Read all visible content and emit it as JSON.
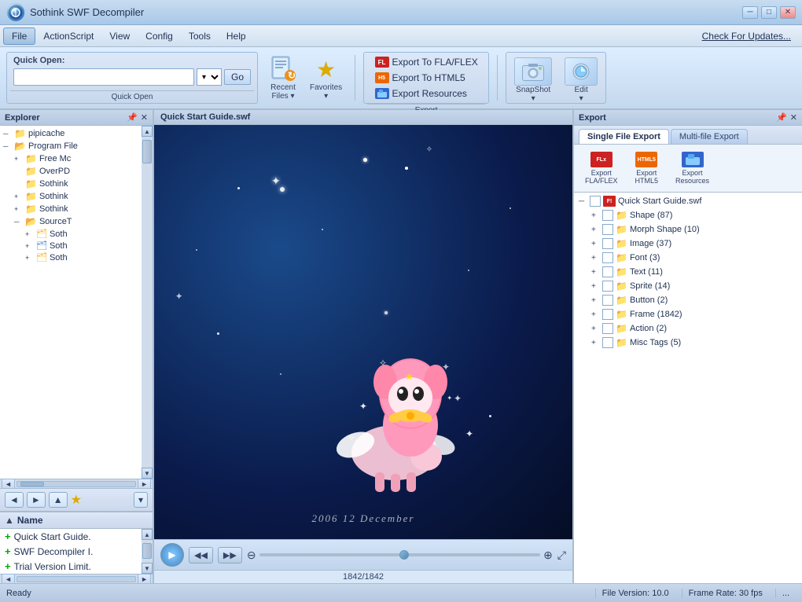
{
  "app": {
    "title": "Sothink SWF Decompiler",
    "icon": "◎"
  },
  "titleBar": {
    "title": "Sothink SWF Decompiler",
    "minimizeLabel": "─",
    "maximizeLabel": "□",
    "closeLabel": "✕"
  },
  "menuBar": {
    "items": [
      "File",
      "ActionScript",
      "View",
      "Config",
      "Tools",
      "Help"
    ],
    "activeItem": "File",
    "checkUpdates": "Check For Updates..."
  },
  "toolbar": {
    "quickOpenLabel": "Quick Open:",
    "goButton": "Go",
    "recentFilesLabel": "Recent\nFiles ▾",
    "favoritesLabel": "Favorites\n▾",
    "exportFlaFlexLabel": "Export To FLA/FLEX",
    "exportHtml5Label": "Export To HTML5",
    "exportResourcesLabel": "Export Resources",
    "exportSectionLabel": "Export",
    "snapshotLabel": "SnapShot\n▾",
    "editLabel": "Edit\n▾",
    "snapshotSectionLabel": "SnapShot",
    "quickOpenSectionLabel": "Quick Open"
  },
  "explorerPanel": {
    "title": "Explorer",
    "pinIcon": "📌",
    "closeIcon": "✕",
    "tree": [
      {
        "level": 0,
        "expanded": true,
        "label": "pipicache",
        "type": "folder",
        "expander": "─"
      },
      {
        "level": 0,
        "expanded": true,
        "label": "Program File",
        "type": "folder",
        "expander": "─"
      },
      {
        "level": 1,
        "expanded": false,
        "label": "Free Mc",
        "type": "folder",
        "expander": "+"
      },
      {
        "level": 1,
        "expanded": false,
        "label": "OverPD",
        "type": "folder",
        "expander": ""
      },
      {
        "level": 1,
        "expanded": false,
        "label": "Sothink",
        "type": "folder",
        "expander": ""
      },
      {
        "level": 1,
        "expanded": false,
        "label": "Sothink",
        "type": "folder",
        "expander": "+"
      },
      {
        "level": 1,
        "expanded": false,
        "label": "Sothink",
        "type": "folder",
        "expander": "+"
      },
      {
        "level": 1,
        "expanded": true,
        "label": "SourceT",
        "type": "folder-special",
        "expander": "─"
      },
      {
        "level": 2,
        "expanded": false,
        "label": "Soth",
        "type": "file",
        "expander": "+"
      },
      {
        "level": 2,
        "expanded": false,
        "label": "Soth",
        "type": "file-special",
        "expander": "+"
      },
      {
        "level": 2,
        "expanded": false,
        "label": "Soth",
        "type": "file",
        "expander": "+"
      }
    ]
  },
  "explorerNav": {
    "backLabel": "◄",
    "forwardLabel": "►",
    "upLabel": "▲",
    "starLabel": "★",
    "menuLabel": "▾"
  },
  "fileList": {
    "nameHeader": "Name",
    "files": [
      "Quick Start Guide.",
      "SWF Decompiler I.",
      "Trial Version Limit."
    ]
  },
  "swfPanel": {
    "title": "Quick Start Guide.swf",
    "dateText": "2006 12  December",
    "frameCount": "1842/1842"
  },
  "exportPanel": {
    "title": "Export",
    "pinIcon": "📌",
    "closeIcon": "✕",
    "tabs": [
      "Single File Export",
      "Multi-file Export"
    ],
    "activeTab": "Single File Export",
    "toolbarButtons": [
      {
        "label": "Export\nFLA/FLEX",
        "iconType": "fla"
      },
      {
        "label": "Export\nHTML5",
        "iconType": "html"
      },
      {
        "label": "Export\nResources",
        "iconType": "res"
      }
    ],
    "tree": [
      {
        "level": 0,
        "expanded": true,
        "label": "Quick Start Guide.swf",
        "type": "root",
        "expander": "─"
      },
      {
        "level": 1,
        "expanded": false,
        "label": "Shape (87)",
        "type": "folder",
        "expander": "+"
      },
      {
        "level": 1,
        "expanded": false,
        "label": "Morph Shape (10)",
        "type": "folder",
        "expander": "+"
      },
      {
        "level": 1,
        "expanded": false,
        "label": "Image (37)",
        "type": "folder",
        "expander": "+"
      },
      {
        "level": 1,
        "expanded": false,
        "label": "Font (3)",
        "type": "folder",
        "expander": "+"
      },
      {
        "level": 1,
        "expanded": false,
        "label": "Text (11)",
        "type": "folder",
        "expander": "+"
      },
      {
        "level": 1,
        "expanded": false,
        "label": "Sprite (14)",
        "type": "folder",
        "expander": "+"
      },
      {
        "level": 1,
        "expanded": false,
        "label": "Button (2)",
        "type": "folder",
        "expander": "+"
      },
      {
        "level": 1,
        "expanded": false,
        "label": "Frame (1842)",
        "type": "folder",
        "expander": "+"
      },
      {
        "level": 1,
        "expanded": false,
        "label": "Action (2)",
        "type": "folder",
        "expander": "+"
      },
      {
        "level": 1,
        "expanded": false,
        "label": "Misc Tags (5)",
        "type": "folder",
        "expander": "+"
      }
    ]
  },
  "statusBar": {
    "readyText": "Ready",
    "fileVersion": "File Version: 10.0",
    "frameRate": "Frame Rate: 30 fps",
    "moreIcon": "..."
  }
}
